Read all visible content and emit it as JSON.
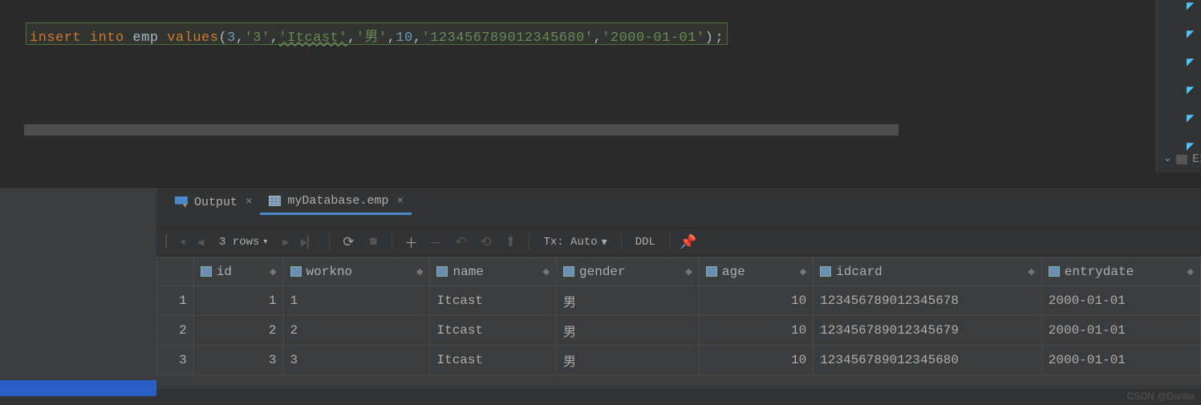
{
  "sql": {
    "keyword1": "insert",
    "keyword2": "into",
    "table": "emp",
    "keyword3": "values",
    "arg1": "3",
    "arg2": "'3'",
    "arg3": "'Itcast'",
    "arg4": "'男'",
    "arg5": "10",
    "arg6": "'123456789012345680'",
    "arg7": "'2000-01-01'"
  },
  "sidebar": {
    "exte_label": "Exte"
  },
  "tabs": {
    "output": "Output",
    "table": "myDatabase.emp"
  },
  "toolbar": {
    "rows": "3 rows",
    "tx": "Tx: Auto",
    "ddl": "DDL"
  },
  "columns": {
    "id": "id",
    "workno": "workno",
    "name": "name",
    "gender": "gender",
    "age": "age",
    "idcard": "idcard",
    "entrydate": "entrydate"
  },
  "rows": [
    {
      "n": "1",
      "id": "1",
      "workno": "1",
      "name": "Itcast",
      "gender": "男",
      "age": "10",
      "idcard": "12345678901234567­8",
      "entry": "2000-01-01"
    },
    {
      "n": "2",
      "id": "2",
      "workno": "2",
      "name": "Itcast",
      "gender": "男",
      "age": "10",
      "idcard": "123456789012345679",
      "entry": "2000-01-01"
    },
    {
      "n": "3",
      "id": "3",
      "workno": "3",
      "name": "Itcast",
      "gender": "男",
      "age": "10",
      "idcard": "123456789012345680",
      "entry": "2000-01-01"
    }
  ],
  "chart_data": {
    "type": "table",
    "columns": [
      "id",
      "workno",
      "name",
      "gender",
      "age",
      "idcard",
      "entrydate"
    ],
    "rows": [
      [
        1,
        "1",
        "Itcast",
        "男",
        10,
        "123456789012345678",
        "2000-01-01"
      ],
      [
        2,
        "2",
        "Itcast",
        "男",
        10,
        "123456789012345679",
        "2000-01-01"
      ],
      [
        3,
        "3",
        "Itcast",
        "男",
        10,
        "123456789012345680",
        "2000-01-01"
      ]
    ]
  },
  "fixrows": {
    "r0": {
      "idcard": "123456789012345678"
    }
  },
  "watermark": "CSDN @Dontla"
}
